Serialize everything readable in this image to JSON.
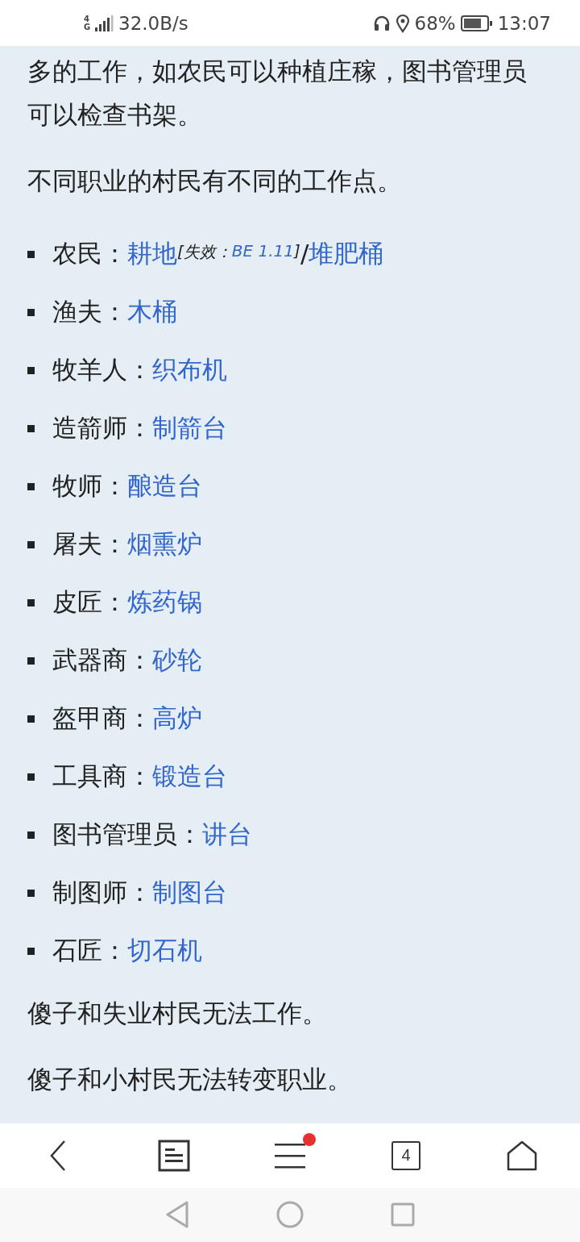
{
  "status_bar": {
    "network_type": "4G",
    "speed": "32.0B/s",
    "battery": "68%",
    "time": "13:07"
  },
  "article": {
    "paragraphs_top": [
      "多的工作，如农民可以种植庄稼，图书管理员可以检查书架。",
      "不同职业的村民有不同的工作点。"
    ],
    "list": [
      {
        "label": "农民：",
        "segments": [
          {
            "kind": "link",
            "text": "耕地"
          },
          {
            "kind": "note",
            "prefix": "[失效：",
            "link": "BE 1.11",
            "suffix": "]"
          },
          {
            "kind": "plain",
            "text": "/"
          },
          {
            "kind": "link",
            "text": "堆肥桶"
          }
        ]
      },
      {
        "label": "渔夫：",
        "segments": [
          {
            "kind": "link",
            "text": "木桶"
          }
        ]
      },
      {
        "label": "牧羊人：",
        "segments": [
          {
            "kind": "link",
            "text": "织布机"
          }
        ]
      },
      {
        "label": "造箭师：",
        "segments": [
          {
            "kind": "link",
            "text": "制箭台"
          }
        ]
      },
      {
        "label": "牧师：",
        "segments": [
          {
            "kind": "link",
            "text": "酿造台"
          }
        ]
      },
      {
        "label": "屠夫：",
        "segments": [
          {
            "kind": "link",
            "text": "烟熏炉"
          }
        ]
      },
      {
        "label": "皮匠：",
        "segments": [
          {
            "kind": "link",
            "text": "炼药锅"
          }
        ]
      },
      {
        "label": "武器商：",
        "segments": [
          {
            "kind": "link",
            "text": "砂轮"
          }
        ]
      },
      {
        "label": "盔甲商：",
        "segments": [
          {
            "kind": "link",
            "text": "高炉"
          }
        ]
      },
      {
        "label": "工具商：",
        "segments": [
          {
            "kind": "link",
            "text": "锻造台"
          }
        ]
      },
      {
        "label": "图书管理员：",
        "segments": [
          {
            "kind": "link",
            "text": "讲台"
          }
        ]
      },
      {
        "label": "制图师：",
        "segments": [
          {
            "kind": "link",
            "text": "制图台"
          }
        ]
      },
      {
        "label": "石匠：",
        "segments": [
          {
            "kind": "link",
            "text": "切石机"
          }
        ]
      }
    ],
    "paragraphs_bottom": [
      "傻子和失业村民无法工作。",
      "傻子和小村民无法转变职业。"
    ]
  },
  "browser_toolbar": {
    "menu_has_notification": true,
    "tab_count": "4"
  }
}
